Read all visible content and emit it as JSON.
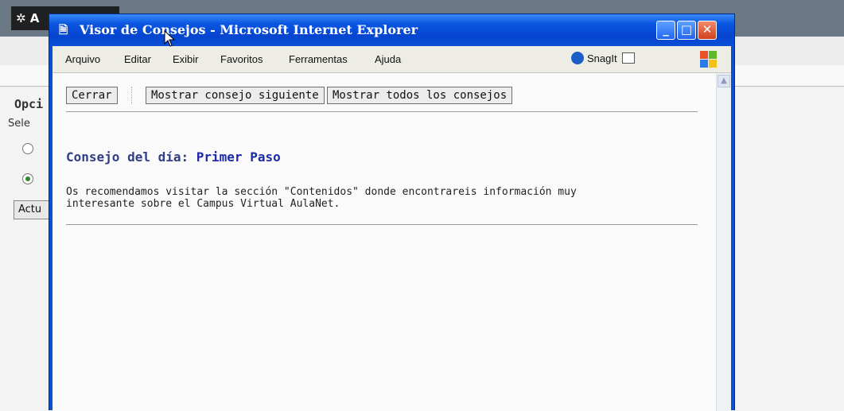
{
  "background_page": {
    "logo_text": "A",
    "heading": "Opci",
    "subtitle": "Sele",
    "radio_options": [
      {
        "checked": false
      },
      {
        "checked": true
      }
    ],
    "button_label": "Actu"
  },
  "window": {
    "title": "Visor de Consejos - Microsoft Internet Explorer",
    "controls": {
      "minimize": "_",
      "maximize": "□",
      "close": "✕"
    }
  },
  "menubar": {
    "items": [
      "Arquivo",
      "Editar",
      "Exibir",
      "Favoritos",
      "Ferramentas",
      "Ajuda"
    ],
    "snagit_label": "SnagIt"
  },
  "toolbar": {
    "close_label": "Cerrar",
    "next_label": "Mostrar consejo siguiente",
    "all_label": "Mostrar todos los consejos"
  },
  "tip": {
    "heading_prefix": "Consejo del día:",
    "title": "Primer Paso",
    "body_line1": "Os recomendamos visitar la sección \"Contenidos\" donde encontrareis información muy",
    "body_line2": "interesante sobre el Campus Virtual AulaNet."
  },
  "colors": {
    "titlebar": "#0a4fd6",
    "tip_heading": "#2f3e86",
    "tip_title": "#1b2aa8"
  }
}
